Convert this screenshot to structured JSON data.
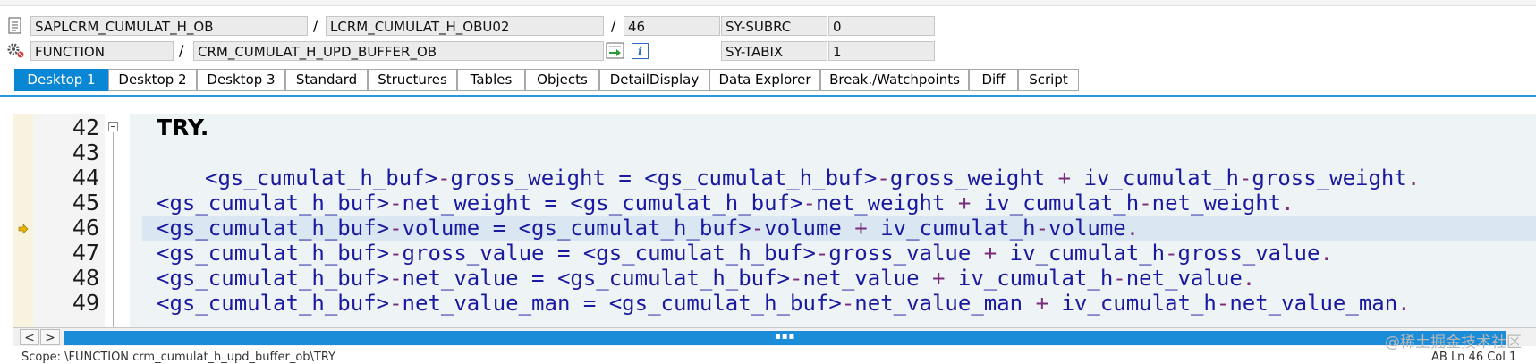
{
  "header": {
    "row1": {
      "program": "SAPLCRM_CUMULAT_H_OB",
      "include": "LCRM_CUMULAT_H_OBU02",
      "line": "46",
      "sysfield_name": "SY-SUBRC",
      "sysfield_value": "0"
    },
    "row2": {
      "event_type": "FUNCTION",
      "event_name": "CRM_CUMULAT_H_UPD_BUFFER_OB",
      "sysfield_name": "SY-TABIX",
      "sysfield_value": "1"
    },
    "separator": "/",
    "info_glyph": "i"
  },
  "tabs": [
    {
      "label": "Desktop 1",
      "active": true
    },
    {
      "label": "Desktop 2",
      "active": false
    },
    {
      "label": "Desktop 3",
      "active": false
    },
    {
      "label": "Standard",
      "active": false
    },
    {
      "label": "Structures",
      "active": false
    },
    {
      "label": "Tables",
      "active": false
    },
    {
      "label": "Objects",
      "active": false
    },
    {
      "label": "DetailDisplay",
      "active": false
    },
    {
      "label": "Data Explorer",
      "active": false
    },
    {
      "label": "Break./Watchpoints",
      "active": false
    },
    {
      "label": "Diff",
      "active": false
    },
    {
      "label": "Script",
      "active": false
    }
  ],
  "editor": {
    "current_line": 46,
    "lines": [
      {
        "n": "42",
        "code": "TRY."
      },
      {
        "n": "43",
        "code": ""
      },
      {
        "n": "44",
        "code": "<gs_cumulat_h_buf>-gross_weight = <gs_cumulat_h_buf>-gross_weight + iv_cumulat_h-gross_weight."
      },
      {
        "n": "45",
        "code": "<gs_cumulat_h_buf>-net_weight = <gs_cumulat_h_buf>-net_weight + iv_cumulat_h-net_weight."
      },
      {
        "n": "46",
        "code": "<gs_cumulat_h_buf>-volume = <gs_cumulat_h_buf>-volume + iv_cumulat_h-volume."
      },
      {
        "n": "47",
        "code": "<gs_cumulat_h_buf>-gross_value = <gs_cumulat_h_buf>-gross_value + iv_cumulat_h-gross_value."
      },
      {
        "n": "48",
        "code": "<gs_cumulat_h_buf>-net_value = <gs_cumulat_h_buf>-net_value + iv_cumulat_h-net_value."
      },
      {
        "n": "49",
        "code": "<gs_cumulat_h_buf>-net_value_man = <gs_cumulat_h_buf>-net_value_man + iv_cumulat_h-net_value_man."
      }
    ]
  },
  "scrollbar": {
    "left_arrow": "<",
    "right_arrow": ">",
    "grip": "▪▪▪"
  },
  "status": {
    "scope": "Scope: \\FUNCTION crm_cumulat_h_upd_buffer_ob\\TRY",
    "position": "AB  Ln 46 Col 1"
  },
  "watermark": "@稀土掘金技术社区",
  "colors": {
    "accent": "#0a87d4",
    "current_line_bg": "#dbe6f3",
    "marker": "#e8b400"
  }
}
